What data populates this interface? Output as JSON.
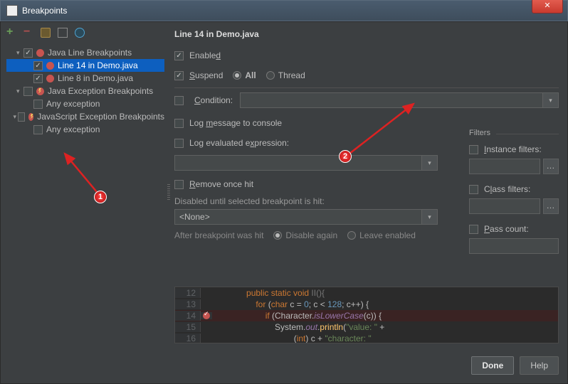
{
  "window": {
    "title": "Breakpoints"
  },
  "tree": {
    "node0": {
      "label": "Java Line Breakpoints"
    },
    "node0_0": {
      "label": "Line 14 in Demo.java"
    },
    "node0_1": {
      "label": "Line 8 in Demo.java"
    },
    "node1": {
      "label": "Java Exception Breakpoints"
    },
    "node1_0": {
      "label": "Any exception"
    },
    "node2": {
      "label": "JavaScript Exception Breakpoints"
    },
    "node2_0": {
      "label": "Any exception"
    }
  },
  "detail": {
    "title": "Line 14 in Demo.java",
    "enabled": "Enabled",
    "suspend": "Suspend",
    "all": "All",
    "thread": "Thread",
    "condition": "Condition:",
    "logmsg": "Log message to console",
    "logexpr": "Log evaluated expression:",
    "remove": "Remove once hit",
    "disabled_until": "Disabled until selected breakpoint is hit:",
    "none": "<None>",
    "after_hit": "After breakpoint was hit",
    "dis_again": "Disable again",
    "leave": "Leave enabled"
  },
  "filters": {
    "title": "Filters",
    "instance": "Instance filters:",
    "classf": "Class filters:",
    "pass": "Pass count:"
  },
  "code": {
    "l12": "            public static void II(){",
    "l13": "                for (char c = 0; c < 128; c++) {",
    "l14": "                    if (Character.isLowerCase(c)) {",
    "l15": "                        System.out.println(\"value: \" +",
    "l16": "                                (int) c + \"character: \""
  },
  "buttons": {
    "done": "Done",
    "help": "Help"
  },
  "ann": {
    "n1": "1",
    "n2": "2"
  }
}
